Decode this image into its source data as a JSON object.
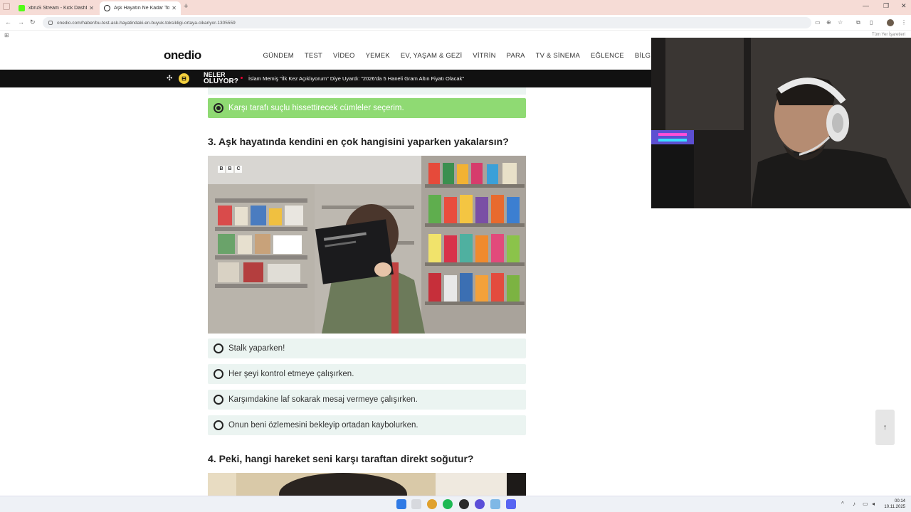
{
  "browser": {
    "tabs": [
      {
        "title": "xbruS Stream - Kick Dashboard",
        "active": false,
        "favicon_color": "#53fc18"
      },
      {
        "title": "Aşk Hayatın Ne Kadar Toksik B",
        "active": true,
        "favicon_color": "#111111"
      }
    ],
    "new_tab_label": "+",
    "url": "onedio.com/haber/bu-test-ask-hayatindaki-en-buyuk-toksikligi-ortaya-cikariyor-1305559",
    "all_bookmarks_label": "Tüm Yer İşaretleri"
  },
  "site": {
    "logo": "onedio",
    "nav": [
      "GÜNDEM",
      "TEST",
      "VİDEO",
      "YEMEK",
      "EV, YAŞAM & GEZİ",
      "VİTRİN",
      "PARA",
      "TV & SİNEMA",
      "EĞLENCE",
      "BİLGİSEL"
    ],
    "ticker": {
      "label_line1": "NELER",
      "label_line2": "OLUYOR?",
      "headline": "İslam Memiş \"İlk Kez Açıklıyorum\" Diye Uyardı: \"2026'da 5 Haneli Gram Altın Fiyatı Olacak\""
    }
  },
  "quiz": {
    "q2_selected_option": "Karşı tarafı suçlu hissettirecek cümleler seçerim.",
    "question3": {
      "title": "3. Aşk hayatında kendini en çok hangisini yaparken yakalarsın?",
      "image_watermark": [
        "B",
        "B",
        "C"
      ],
      "options": [
        "Stalk yaparken!",
        "Her şeyi kontrol etmeye çalışırken.",
        "Karşımdakine laf sokarak mesaj vermeye çalışırken.",
        "Onun beni özlemesini bekleyip ortadan kaybolurken."
      ]
    },
    "question4": {
      "title": "4. Peki, hangi hareket seni karşı taraftan direkt soğutur?"
    }
  },
  "scroll_top_label": "↑",
  "taskbar": {
    "time": "00:14",
    "date": "10.11.2025"
  },
  "colors": {
    "selected_option": "#8fda73",
    "option_bg": "#ebf4f1",
    "ticker_bg": "#111111",
    "ticker_badge": "#f3d03e"
  }
}
